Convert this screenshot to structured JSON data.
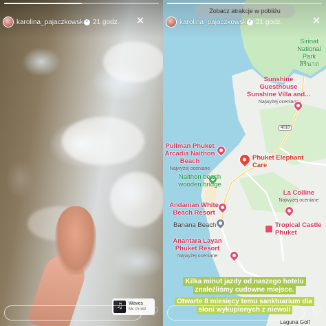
{
  "left_story": {
    "username": "karolina_pajaczkowska",
    "time": "21 godz.",
    "progress": 0.5,
    "music": {
      "title": "Waves",
      "artist": "Mr. Probz"
    }
  },
  "right_story": {
    "username": "karolina_pajaczkowska",
    "time": "21 godz.",
    "progress": 0.5,
    "attractions_button": "Zobacz atrakcje w pobliżu",
    "map": {
      "places": [
        {
          "name": "Sirinat National Park",
          "line2": "สิรินาถ"
        },
        {
          "name": "Sunshine Guesthouse Sunshine Villa and...",
          "sub": "Najwyżej oceniane"
        },
        {
          "name": "Pullman Phuket Arcadia Naithon Beach",
          "sub": "Najwyżej oceniane"
        },
        {
          "name": "Phuket Elephant Care"
        },
        {
          "name": "Naithon beach wooden bridge"
        },
        {
          "name": "Andaman White Beach Resort"
        },
        {
          "name": "Banana Beach"
        },
        {
          "name": "Anantara Layan Phuket Resort",
          "sub": "Najwyżej oceniane"
        },
        {
          "name": "La Colline",
          "sub": "Najwyżej oceniane"
        },
        {
          "name": "Tropical Castle Phuket"
        },
        {
          "name": "Laguna Golf"
        }
      ],
      "road_number": "4018"
    },
    "caption_1": "Kilka minut jazdy od naszego hotelu znaleźliśmy cudowne miejsce.",
    "caption_2": "Otwarte 8 miesięcy temu sanktuarium dla słoni wykupionych z niewoli"
  },
  "icons": {
    "close": "close-icon",
    "verified": "verified-badge-icon",
    "heart": "heart-icon",
    "pin": "map-pin-icon"
  },
  "colors": {
    "water": "#9fd3e6",
    "land": "#eef0eb",
    "park": "#c9e9c0",
    "pin_pink": "#e64a6c",
    "pin_red": "#ea4335",
    "caption_bg": "#a9c94a"
  }
}
